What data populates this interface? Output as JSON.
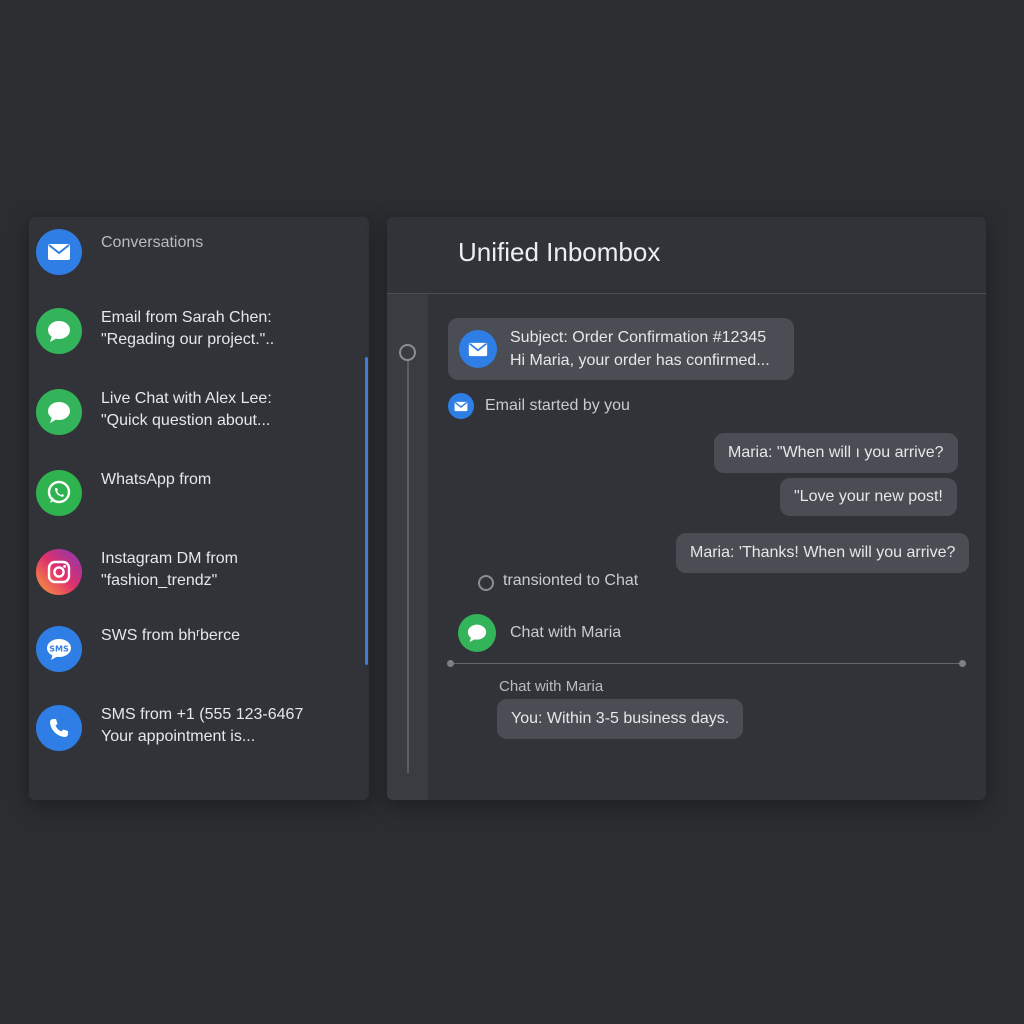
{
  "sidebar": {
    "header": {
      "label": "Conversations",
      "icon": "mail-icon"
    },
    "items": [
      {
        "line1": "Email from Sarah Chen:",
        "line2": "\"Regading our project.\"..",
        "icon": "chat-icon",
        "color": "#34b45a"
      },
      {
        "line1": "Live Chat with Alex Lee:",
        "line2": "\"Quick question about...",
        "icon": "chat-icon",
        "color": "#34b45a"
      },
      {
        "line1": "WhatsApp from",
        "line2": "",
        "icon": "whatsapp-icon",
        "color": "#2fb34f"
      },
      {
        "line1": "Instagram DM from",
        "line2": "\"fashion_trendz\"",
        "icon": "instagram-icon",
        "color": "#c13584"
      },
      {
        "line1": "SWS from bhʳberce",
        "line2": "",
        "icon": "sms-icon",
        "color": "#2f7ee6"
      },
      {
        "line1": "SMS from +1 (555 123-6467",
        "line2": "Your appointment is...",
        "icon": "phone-icon",
        "color": "#2f7ee6"
      }
    ]
  },
  "main": {
    "title": "Unified Inbombox",
    "email": {
      "subject": "Subject: Order Confirmation #12345",
      "preview": "Hi Maria, your order has confirmed..."
    },
    "email_started": "Email started by you",
    "messages": [
      "Maria: \"When will ı you arrive?",
      "\"Love your new post!",
      "Maria: 'Thanks! When will you arrive?"
    ],
    "transition": "transionted to Chat",
    "chat_row": "Chat with Maria",
    "chat_label": "Chat with Maria",
    "reply": "You: Within 3-5 business days."
  },
  "colors": {
    "background": "#2b2d31",
    "panel": "#313338",
    "accent_blue": "#2f7ee6",
    "accent_green": "#34b45a"
  }
}
